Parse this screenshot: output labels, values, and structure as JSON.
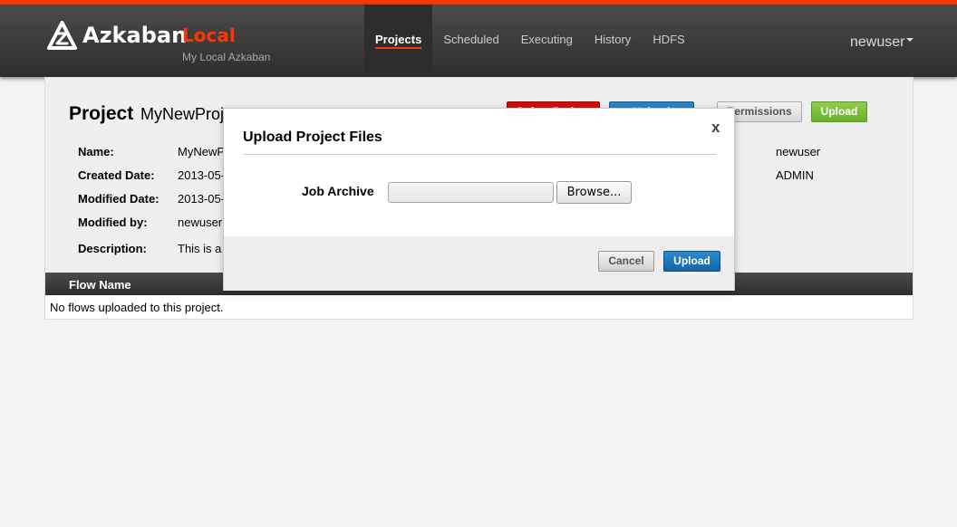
{
  "brand": {
    "name": "Azkaban",
    "env": "Local",
    "subtitle": "My Local Azkaban",
    "accent_color": "#ff3601"
  },
  "nav": {
    "items": [
      {
        "label": "Projects",
        "active": true
      },
      {
        "label": "Scheduled",
        "active": false
      },
      {
        "label": "Executing",
        "active": false
      },
      {
        "label": "History",
        "active": false
      },
      {
        "label": "HDFS",
        "active": false
      }
    ]
  },
  "user_menu": {
    "label": "newuser"
  },
  "project": {
    "title": "Project",
    "name": "MyNewProj",
    "buttons": {
      "delete": "Delete Project",
      "upload_top": "Upload",
      "permissions": "Permissions",
      "upload": "Upload"
    },
    "fields": [
      {
        "label": "Name:",
        "value": "MyNewP"
      },
      {
        "label": "Created Date:",
        "value": "2013-05-"
      },
      {
        "label": "Modified Date:",
        "value": "2013-05-"
      },
      {
        "label": "Modified by:",
        "value": "newuser"
      },
      {
        "label": "Description:",
        "value": "This is a"
      }
    ],
    "side_values": [
      "newuser",
      "ADMIN"
    ]
  },
  "flows": {
    "header": "Flow Name",
    "empty_message": "No flows uploaded to this project."
  },
  "modal": {
    "title": "Upload Project Files",
    "close_label": "x",
    "field_label": "Job Archive",
    "browse_label": "Browse...",
    "cancel_label": "Cancel",
    "upload_label": "Upload"
  }
}
